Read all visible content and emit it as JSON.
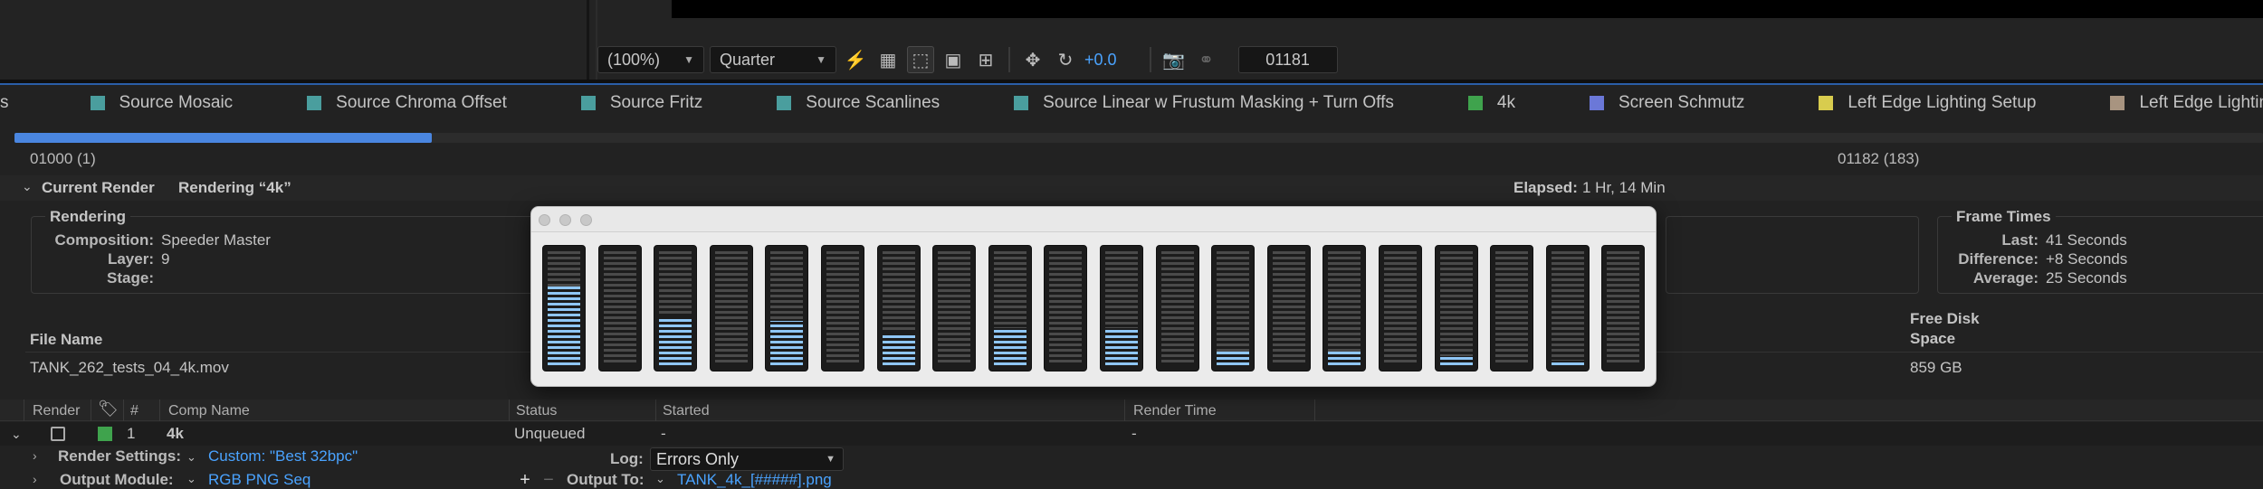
{
  "viewer": {
    "zoom": "(100%)",
    "resolution": "Quarter",
    "exposure": "+0.0",
    "frame": "01181"
  },
  "comp_tabs": [
    {
      "label": "s",
      "color": ""
    },
    {
      "label": "Source Mosaic",
      "color": "#4a9e9e"
    },
    {
      "label": "Source Chroma Offset",
      "color": "#4a9e9e"
    },
    {
      "label": "Source Fritz",
      "color": "#4a9e9e"
    },
    {
      "label": "Source Scanlines",
      "color": "#4a9e9e"
    },
    {
      "label": "Source Linear w Frustum Masking + Turn Offs",
      "color": "#4a9e9e"
    },
    {
      "label": "4k",
      "color": "#3fa34d"
    },
    {
      "label": "Screen Schmutz",
      "color": "#6b78d8"
    },
    {
      "label": "Left Edge Lighting Setup",
      "color": "#d8cc4e"
    },
    {
      "label": "Left Edge Lighting Blur",
      "color": "#a89480"
    }
  ],
  "progress": {
    "fraction": 0.1855,
    "start_label": "01000 (1)",
    "end_label": "01182 (183)"
  },
  "current_render": {
    "title": "Current Render",
    "status": "Rendering “4k”",
    "elapsed_label": "Elapsed:",
    "elapsed_value": "1 Hr, 14 Min"
  },
  "rendering": {
    "title": "Rendering",
    "composition_label": "Composition:",
    "composition_value": "Speeder Master",
    "layer_label": "Layer:",
    "layer_value": "9",
    "stage_label": "Stage:",
    "stage_value": ""
  },
  "frame_times": {
    "title": "Frame Times",
    "last_label": "Last:",
    "last_value": "41 Seconds",
    "difference_label": "Difference:",
    "difference_value": "+8 Seconds",
    "average_label": "Average:",
    "average_value": "25 Seconds"
  },
  "file": {
    "name_label": "File Name",
    "name_value": "TANK_262_tests_04_4k.mov",
    "free_disk_label_1": "Free Disk",
    "free_disk_label_2": "Space",
    "free_disk_value": "859 GB"
  },
  "queue_headers": {
    "render": "Render",
    "number": "#",
    "comp_name": "Comp Name",
    "status": "Status",
    "started": "Started",
    "render_time": "Render Time"
  },
  "queue_row": {
    "number": "1",
    "comp_name": "4k",
    "status": "Unqueued",
    "started": "-",
    "render_time": "-"
  },
  "render_settings": {
    "label": "Render Settings:",
    "value": "Custom: \"Best 32bpc\""
  },
  "log": {
    "label": "Log:",
    "value": "Errors Only"
  },
  "output_module": {
    "label": "Output Module:",
    "value": "RGB PNG Seq",
    "output_to_label": "Output To:",
    "output_to_value": "TANK_4k_[#####].png"
  },
  "cpu_meters": [
    0.68,
    0,
    0.42,
    0,
    0.38,
    0,
    0.28,
    0,
    0.32,
    0,
    0.32,
    0,
    0.12,
    0,
    0.12,
    0,
    0.08,
    0,
    0.04,
    0
  ]
}
